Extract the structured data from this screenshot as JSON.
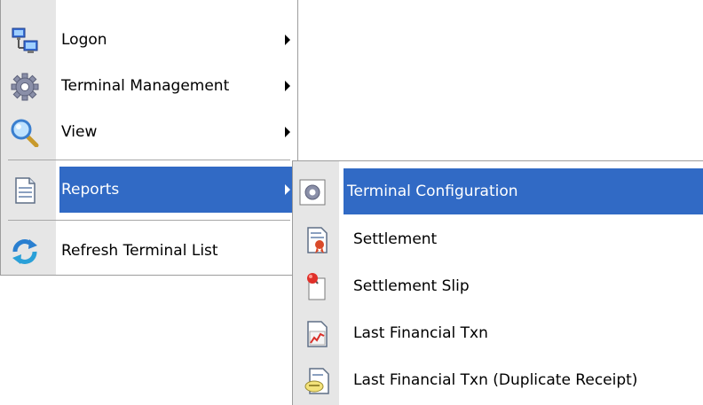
{
  "main_menu": {
    "items": [
      {
        "label": "Logon",
        "icon": "network-computer-icon",
        "has_submenu": true
      },
      {
        "label": "Terminal Management",
        "icon": "gear-icon",
        "has_submenu": true
      },
      {
        "label": "View",
        "icon": "magnifier-icon",
        "has_submenu": true
      },
      {
        "label": "Reports",
        "icon": "document-icon",
        "has_submenu": true,
        "highlighted": true
      },
      {
        "label": "Refresh Terminal List",
        "icon": "refresh-icon",
        "has_submenu": false
      }
    ]
  },
  "reports_submenu": {
    "items": [
      {
        "label": "Terminal Configuration",
        "icon": "gear-document-icon",
        "highlighted": true
      },
      {
        "label": "Settlement",
        "icon": "certificate-document-icon"
      },
      {
        "label": "Settlement Slip",
        "icon": "pinned-slip-icon"
      },
      {
        "label": "Last Financial Txn",
        "icon": "chart-document-icon"
      },
      {
        "label": "Last Financial Txn (Duplicate Receipt)",
        "icon": "receipt-document-icon"
      }
    ]
  },
  "colors": {
    "highlight": "#316ac5",
    "gutter": "#e6e6e6",
    "border": "#9d9d9d"
  }
}
